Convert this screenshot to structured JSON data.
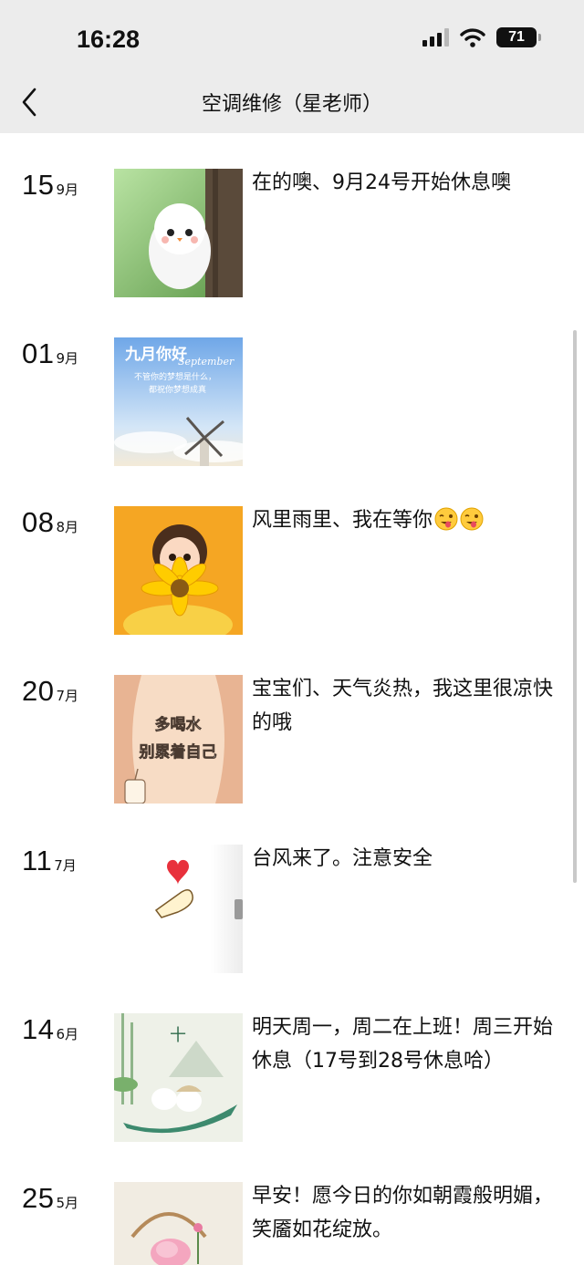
{
  "status": {
    "time": "16:28",
    "battery": "71"
  },
  "header": {
    "title": "空调维修（星老师）"
  },
  "posts": [
    {
      "day": "15",
      "month": "9月",
      "text": "在的噢、9月24号开始休息噢",
      "image": "fluffy-chick-tree"
    },
    {
      "day": "01",
      "month": "9月",
      "text": "",
      "image": "september-windmill",
      "image_text": {
        "title": "九月你好",
        "sub": "September",
        "line1": "不管你的梦想是什么，",
        "line2": "都祝你梦想成真"
      }
    },
    {
      "day": "08",
      "month": "8月",
      "text": "风里雨里、我在等你",
      "image": "girl-sunflower",
      "emoji": [
        "winking-tongue-emoji",
        "winking-tongue-emoji"
      ]
    },
    {
      "day": "20",
      "month": "7月",
      "text": "宝宝们、天气炎热，我这里很凉快的哦",
      "image": "drink-water-card",
      "image_text": {
        "line1": "多喝水",
        "line2": "别累着自己"
      }
    },
    {
      "day": "11",
      "month": "7月",
      "text": "台风来了。注意安全",
      "image": "finger-heart"
    },
    {
      "day": "14",
      "month": "6月",
      "text": "明天周一，周二在上班！周三开始休息（17号到28号休息哈）",
      "image": "dragon-boat-zongzi"
    },
    {
      "day": "25",
      "month": "5月",
      "text": "早安！愿今日的你如朝霞般明媚，笑靥如花绽放。",
      "image": "flower-basket"
    }
  ]
}
